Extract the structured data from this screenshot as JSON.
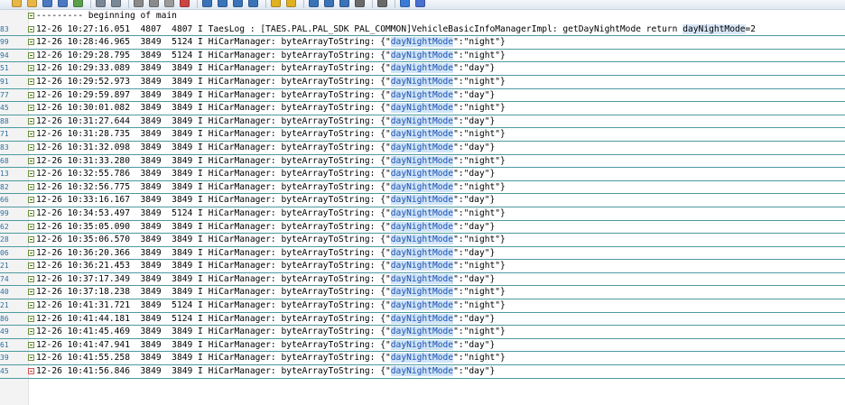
{
  "toolbar": {
    "icons": [
      "new-file-icon",
      "open-folder-icon",
      "save-icon",
      "save-all-icon",
      "reload-icon",
      "undo-icon",
      "redo-icon",
      "cut-icon",
      "copy-icon",
      "paste-icon",
      "delete-icon",
      "find-icon",
      "replace-icon",
      "find-in-files-icon",
      "zoom-icon",
      "bookmark-icon",
      "bookmark-next-icon",
      "find-prev-icon",
      "find-next-icon",
      "find-mark-icon",
      "word-wrap-icon",
      "settings-icon",
      "pin-icon",
      "close-icon"
    ]
  },
  "editor": {
    "header_line": "--------- beginning of main",
    "highlight_term": "dayNightMode",
    "lines": [
      {
        "ln": "83",
        "pre": "12-26 10:27:16.051  4807  4807 I TaesLog : [TAES.PAL.PAL_SDK PAL_COMMON]VehicleBasicInfoManagerImpl: getDayNightMode return ",
        "term": "dayNightMode",
        "post": "=2"
      },
      {
        "ln": "99",
        "pre": "12-26 10:28:46.965  3849  5124 I HiCarManager: byteArrayToString: {\"",
        "term": "dayNightMode",
        "post": "\":\"night\"}"
      },
      {
        "ln": "94",
        "pre": "12-26 10:29:28.795  3849  5124 I HiCarManager: byteArrayToString: {\"",
        "term": "dayNightMode",
        "post": "\":\"night\"}"
      },
      {
        "ln": "51",
        "pre": "12-26 10:29:33.089  3849  3849 I HiCarManager: byteArrayToString: {\"",
        "term": "dayNightMode",
        "post": "\":\"day\"}"
      },
      {
        "ln": "91",
        "pre": "12-26 10:29:52.973  3849  3849 I HiCarManager: byteArrayToString: {\"",
        "term": "dayNightMode",
        "post": "\":\"night\"}"
      },
      {
        "ln": "77",
        "pre": "12-26 10:29:59.897  3849  3849 I HiCarManager: byteArrayToString: {\"",
        "term": "dayNightMode",
        "post": "\":\"day\"}"
      },
      {
        "ln": "45",
        "pre": "12-26 10:30:01.082  3849  3849 I HiCarManager: byteArrayToString: {\"",
        "term": "dayNightMode",
        "post": "\":\"night\"}"
      },
      {
        "ln": "88",
        "pre": "12-26 10:31:27.644  3849  3849 I HiCarManager: byteArrayToString: {\"",
        "term": "dayNightMode",
        "post": "\":\"day\"}"
      },
      {
        "ln": "71",
        "pre": "12-26 10:31:28.735  3849  3849 I HiCarManager: byteArrayToString: {\"",
        "term": "dayNightMode",
        "post": "\":\"night\"}"
      },
      {
        "ln": "83",
        "pre": "12-26 10:31:32.098  3849  3849 I HiCarManager: byteArrayToString: {\"",
        "term": "dayNightMode",
        "post": "\":\"day\"}"
      },
      {
        "ln": "68",
        "pre": "12-26 10:31:33.280  3849  3849 I HiCarManager: byteArrayToString: {\"",
        "term": "dayNightMode",
        "post": "\":\"night\"}"
      },
      {
        "ln": "13",
        "pre": "12-26 10:32:55.786  3849  3849 I HiCarManager: byteArrayToString: {\"",
        "term": "dayNightMode",
        "post": "\":\"day\"}"
      },
      {
        "ln": "82",
        "pre": "12-26 10:32:56.775  3849  3849 I HiCarManager: byteArrayToString: {\"",
        "term": "dayNightMode",
        "post": "\":\"night\"}"
      },
      {
        "ln": "66",
        "pre": "12-26 10:33:16.167  3849  3849 I HiCarManager: byteArrayToString: {\"",
        "term": "dayNightMode",
        "post": "\":\"day\"}"
      },
      {
        "ln": "99",
        "pre": "12-26 10:34:53.497  3849  5124 I HiCarManager: byteArrayToString: {\"",
        "term": "dayNightMode",
        "post": "\":\"night\"}"
      },
      {
        "ln": "62",
        "pre": "12-26 10:35:05.090  3849  3849 I HiCarManager: byteArrayToString: {\"",
        "term": "dayNightMode",
        "post": "\":\"day\"}"
      },
      {
        "ln": "28",
        "pre": "12-26 10:35:06.570  3849  3849 I HiCarManager: byteArrayToString: {\"",
        "term": "dayNightMode",
        "post": "\":\"night\"}"
      },
      {
        "ln": "06",
        "pre": "12-26 10:36:20.366  3849  3849 I HiCarManager: byteArrayToString: {\"",
        "term": "dayNightMode",
        "post": "\":\"day\"}"
      },
      {
        "ln": "21",
        "pre": "12-26 10:36:21.453  3849  3849 I HiCarManager: byteArrayToString: {\"",
        "term": "dayNightMode",
        "post": "\":\"night\"}"
      },
      {
        "ln": "74",
        "pre": "12-26 10:37:17.349  3849  3849 I HiCarManager: byteArrayToString: {\"",
        "term": "dayNightMode",
        "post": "\":\"day\"}"
      },
      {
        "ln": "40",
        "pre": "12-26 10:37:18.238  3849  3849 I HiCarManager: byteArrayToString: {\"",
        "term": "dayNightMode",
        "post": "\":\"night\"}"
      },
      {
        "ln": "21",
        "pre": "12-26 10:41:31.721  3849  5124 I HiCarManager: byteArrayToString: {\"",
        "term": "dayNightMode",
        "post": "\":\"night\"}"
      },
      {
        "ln": "86",
        "pre": "12-26 10:41:44.181  3849  5124 I HiCarManager: byteArrayToString: {\"",
        "term": "dayNightMode",
        "post": "\":\"day\"}"
      },
      {
        "ln": "49",
        "pre": "12-26 10:41:45.469  3849  3849 I HiCarManager: byteArrayToString: {\"",
        "term": "dayNightMode",
        "post": "\":\"night\"}"
      },
      {
        "ln": "61",
        "pre": "12-26 10:41:47.941  3849  3849 I HiCarManager: byteArrayToString: {\"",
        "term": "dayNightMode",
        "post": "\":\"day\"}"
      },
      {
        "ln": "39",
        "pre": "12-26 10:41:55.258  3849  3849 I HiCarManager: byteArrayToString: {\"",
        "term": "dayNightMode",
        "post": "\":\"night\"}"
      },
      {
        "ln": "45",
        "pre": "12-26 10:41:56.846  3849  3849 I HiCarManager: byteArrayToString: {\"",
        "term": "dayNightMode",
        "post": "\":\"day\"}"
      }
    ]
  },
  "colors": {
    "highlight_bg": "#cfe4f7",
    "row_separator": "#4d9aa0",
    "line_number": "#2b6f9c",
    "last_fold_marker": "#d9534f"
  }
}
